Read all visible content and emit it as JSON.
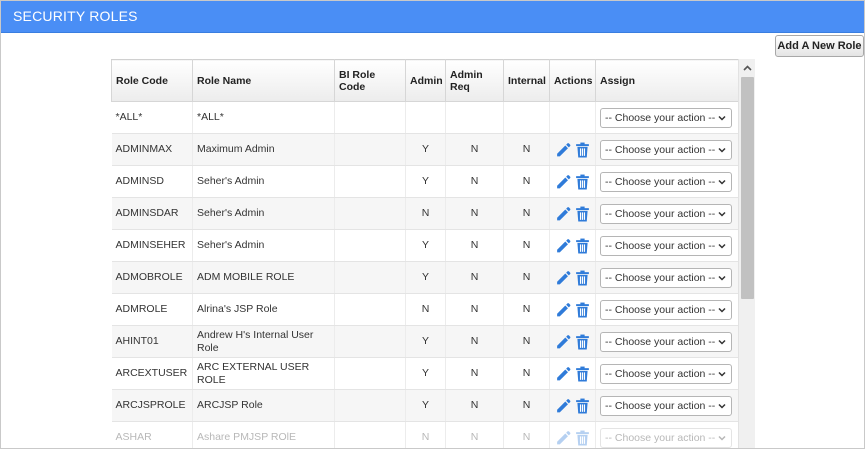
{
  "header": {
    "title": "SECURITY ROLES"
  },
  "toolbar": {
    "add_role_label": "Add A New Role"
  },
  "colors": {
    "header_bg": "#4a8ef5",
    "icon_blue": "#2f7bd9"
  },
  "table": {
    "columns": [
      "Role Code",
      "Role Name",
      "BI Role Code",
      "Admin",
      "Admin Req",
      "Internal",
      "Actions",
      "Assign"
    ],
    "select_placeholder": "-- Choose your action --",
    "rows": [
      {
        "code": "*ALL*",
        "name": "*ALL*",
        "bi": "",
        "admin": "",
        "admin_req": "",
        "internal": ""
      },
      {
        "code": "ADMINMAX",
        "name": "Maximum Admin",
        "bi": "",
        "admin": "Y",
        "admin_req": "N",
        "internal": "N"
      },
      {
        "code": "ADMINSD",
        "name": "Seher's Admin",
        "bi": "",
        "admin": "Y",
        "admin_req": "N",
        "internal": "N"
      },
      {
        "code": "ADMINSDAR",
        "name": "Seher's Admin",
        "bi": "",
        "admin": "N",
        "admin_req": "N",
        "internal": "N"
      },
      {
        "code": "ADMINSEHER",
        "name": "Seher's Admin",
        "bi": "",
        "admin": "Y",
        "admin_req": "N",
        "internal": "N"
      },
      {
        "code": "ADMOBROLE",
        "name": "ADM MOBILE ROLE",
        "bi": "",
        "admin": "Y",
        "admin_req": "N",
        "internal": "N"
      },
      {
        "code": "ADMROLE",
        "name": "Alrina's JSP Role",
        "bi": "",
        "admin": "N",
        "admin_req": "N",
        "internal": "N"
      },
      {
        "code": "AHINT01",
        "name": "Andrew H's Internal User Role",
        "bi": "",
        "admin": "Y",
        "admin_req": "N",
        "internal": "N"
      },
      {
        "code": "ARCEXTUSER",
        "name": "ARC EXTERNAL USER ROLE",
        "bi": "",
        "admin": "Y",
        "admin_req": "N",
        "internal": "N"
      },
      {
        "code": "ARCJSPROLE",
        "name": "ARCJSP Role",
        "bi": "",
        "admin": "Y",
        "admin_req": "N",
        "internal": "N"
      },
      {
        "code": "ASHAR",
        "name": "Ashare PMJSP ROlE",
        "bi": "",
        "admin": "N",
        "admin_req": "N",
        "internal": "N"
      }
    ]
  }
}
